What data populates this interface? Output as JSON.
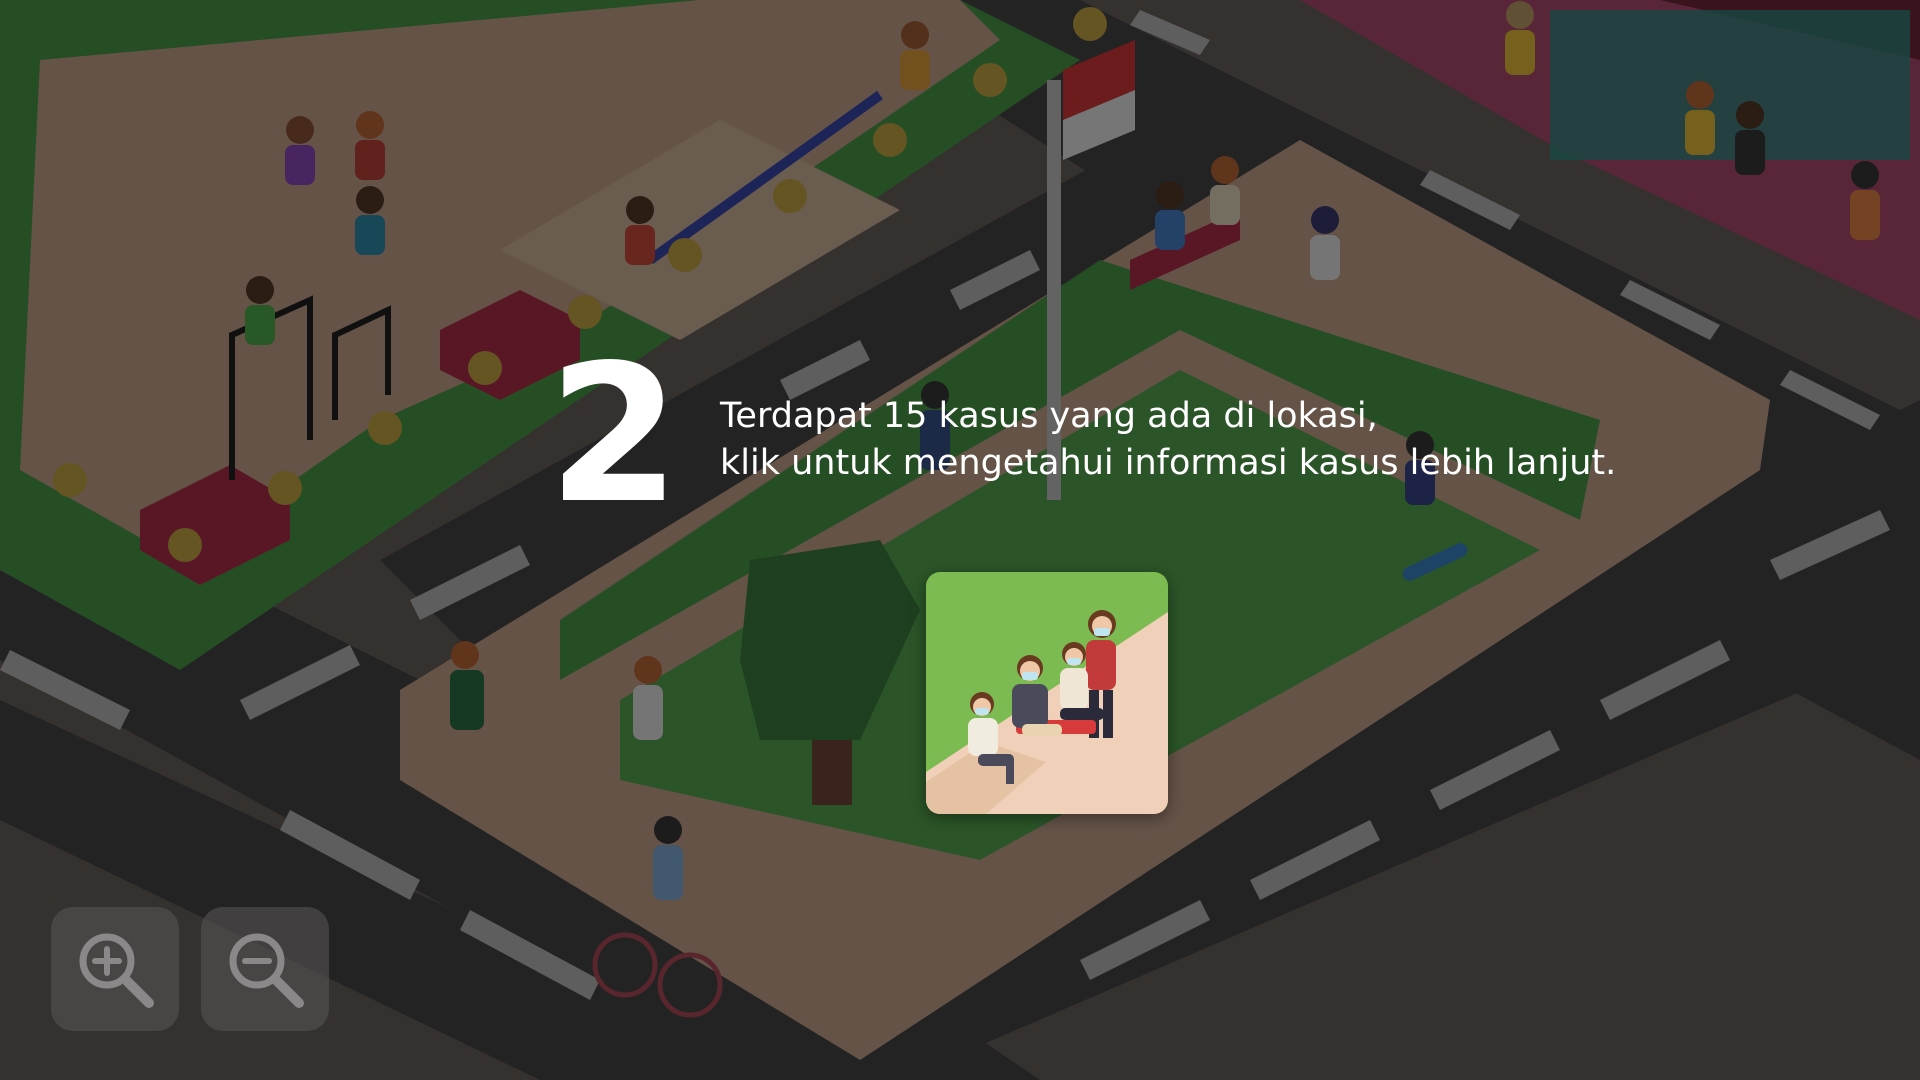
{
  "overlay": {
    "step_number": "2",
    "hint_line_1": "Terdapat 15 kasus yang ada di lokasi,",
    "hint_line_2": "klik untuk mengetahui informasi kasus lebih lanjut."
  },
  "case_card": {
    "icon": "masked-group-sitting-icon",
    "background_color": "#7cbb52"
  },
  "zoom_controls": {
    "zoom_in_icon": "zoom-in-magnifier-icon",
    "zoom_out_icon": "zoom-out-magnifier-icon"
  },
  "scene": {
    "description_icons": [
      "flag-pole-icon",
      "park-bench-icon",
      "seesaw-icon",
      "tree-icon",
      "bicycle-icon",
      "skateboard-icon"
    ],
    "colors": {
      "road": "#3b3b3b",
      "sidewalk": "#caa58c",
      "grass": "#3f9a3d",
      "flag_red": "#d92c2c",
      "building_pink": "#b0406a"
    }
  }
}
